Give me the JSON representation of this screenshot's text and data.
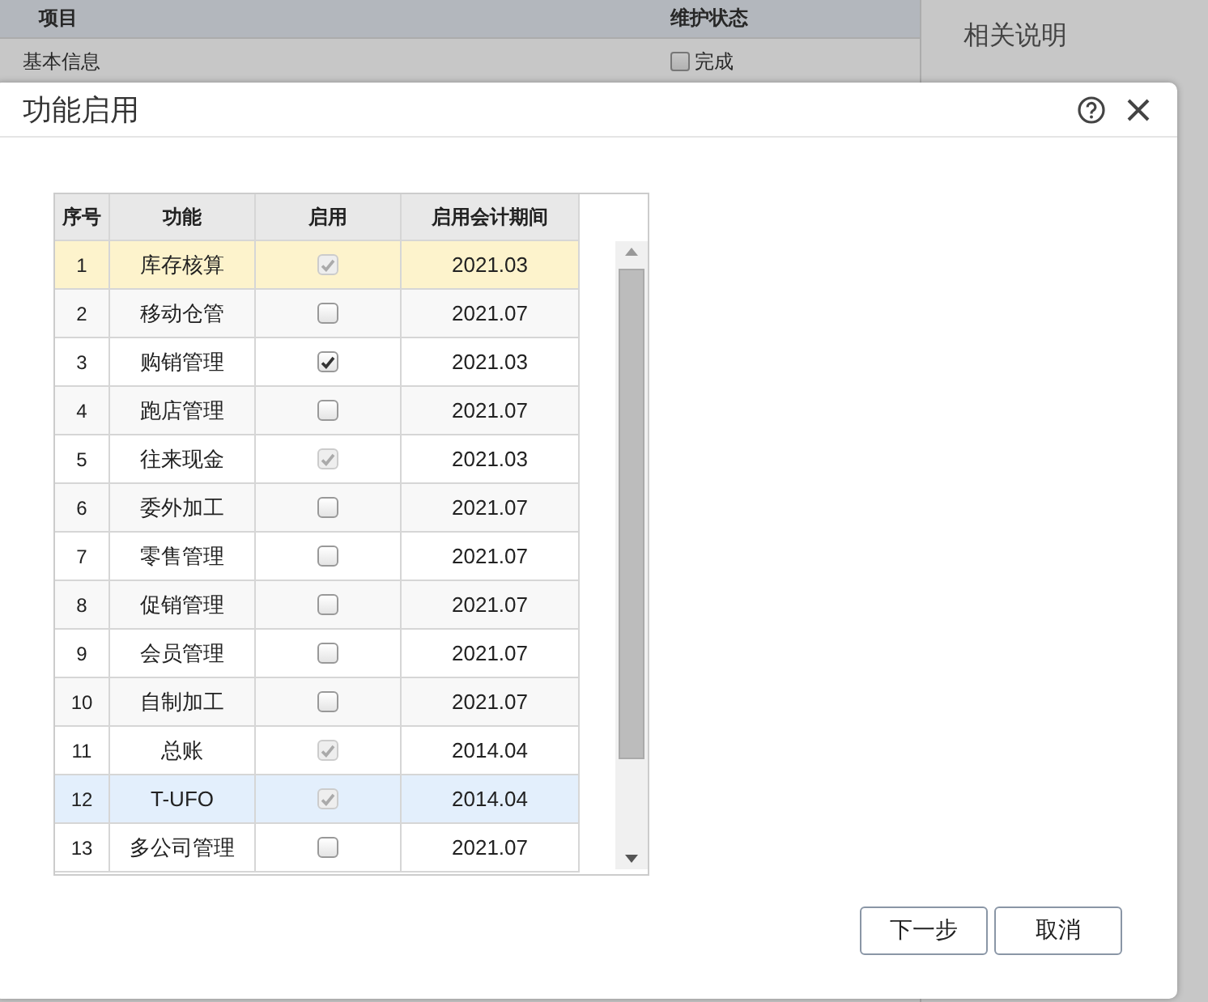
{
  "background": {
    "columns": [
      "项目",
      "维护状态"
    ],
    "rows": [
      {
        "item": "基本信息",
        "status": "完成",
        "checked": false
      }
    ],
    "side_panel": {
      "title": "相关说明"
    }
  },
  "dialog": {
    "title": "功能启用",
    "table": {
      "columns": [
        "序号",
        "功能",
        "启用",
        "启用会计期间"
      ],
      "rows": [
        {
          "no": "1",
          "name": "库存核算",
          "checked": true,
          "disabled": true,
          "period": "2021.03",
          "focused": true,
          "selected": false
        },
        {
          "no": "2",
          "name": "移动仓管",
          "checked": false,
          "disabled": false,
          "period": "2021.07",
          "focused": false,
          "selected": false
        },
        {
          "no": "3",
          "name": "购销管理",
          "checked": true,
          "disabled": false,
          "period": "2021.03",
          "focused": false,
          "selected": false
        },
        {
          "no": "4",
          "name": "跑店管理",
          "checked": false,
          "disabled": false,
          "period": "2021.07",
          "focused": false,
          "selected": false
        },
        {
          "no": "5",
          "name": "往来现金",
          "checked": true,
          "disabled": true,
          "period": "2021.03",
          "focused": false,
          "selected": false
        },
        {
          "no": "6",
          "name": "委外加工",
          "checked": false,
          "disabled": false,
          "period": "2021.07",
          "focused": false,
          "selected": false
        },
        {
          "no": "7",
          "name": "零售管理",
          "checked": false,
          "disabled": false,
          "period": "2021.07",
          "focused": false,
          "selected": false
        },
        {
          "no": "8",
          "name": "促销管理",
          "checked": false,
          "disabled": false,
          "period": "2021.07",
          "focused": false,
          "selected": false
        },
        {
          "no": "9",
          "name": "会员管理",
          "checked": false,
          "disabled": false,
          "period": "2021.07",
          "focused": false,
          "selected": false
        },
        {
          "no": "10",
          "name": "自制加工",
          "checked": false,
          "disabled": false,
          "period": "2021.07",
          "focused": false,
          "selected": false
        },
        {
          "no": "11",
          "name": "总账",
          "checked": true,
          "disabled": true,
          "period": "2014.04",
          "focused": false,
          "selected": false
        },
        {
          "no": "12",
          "name": "T-UFO",
          "checked": true,
          "disabled": true,
          "period": "2014.04",
          "focused": false,
          "selected": true
        },
        {
          "no": "13",
          "name": "多公司管理",
          "checked": false,
          "disabled": false,
          "period": "2021.07",
          "focused": false,
          "selected": false
        }
      ]
    },
    "buttons": [
      "下一步",
      "取消"
    ]
  }
}
